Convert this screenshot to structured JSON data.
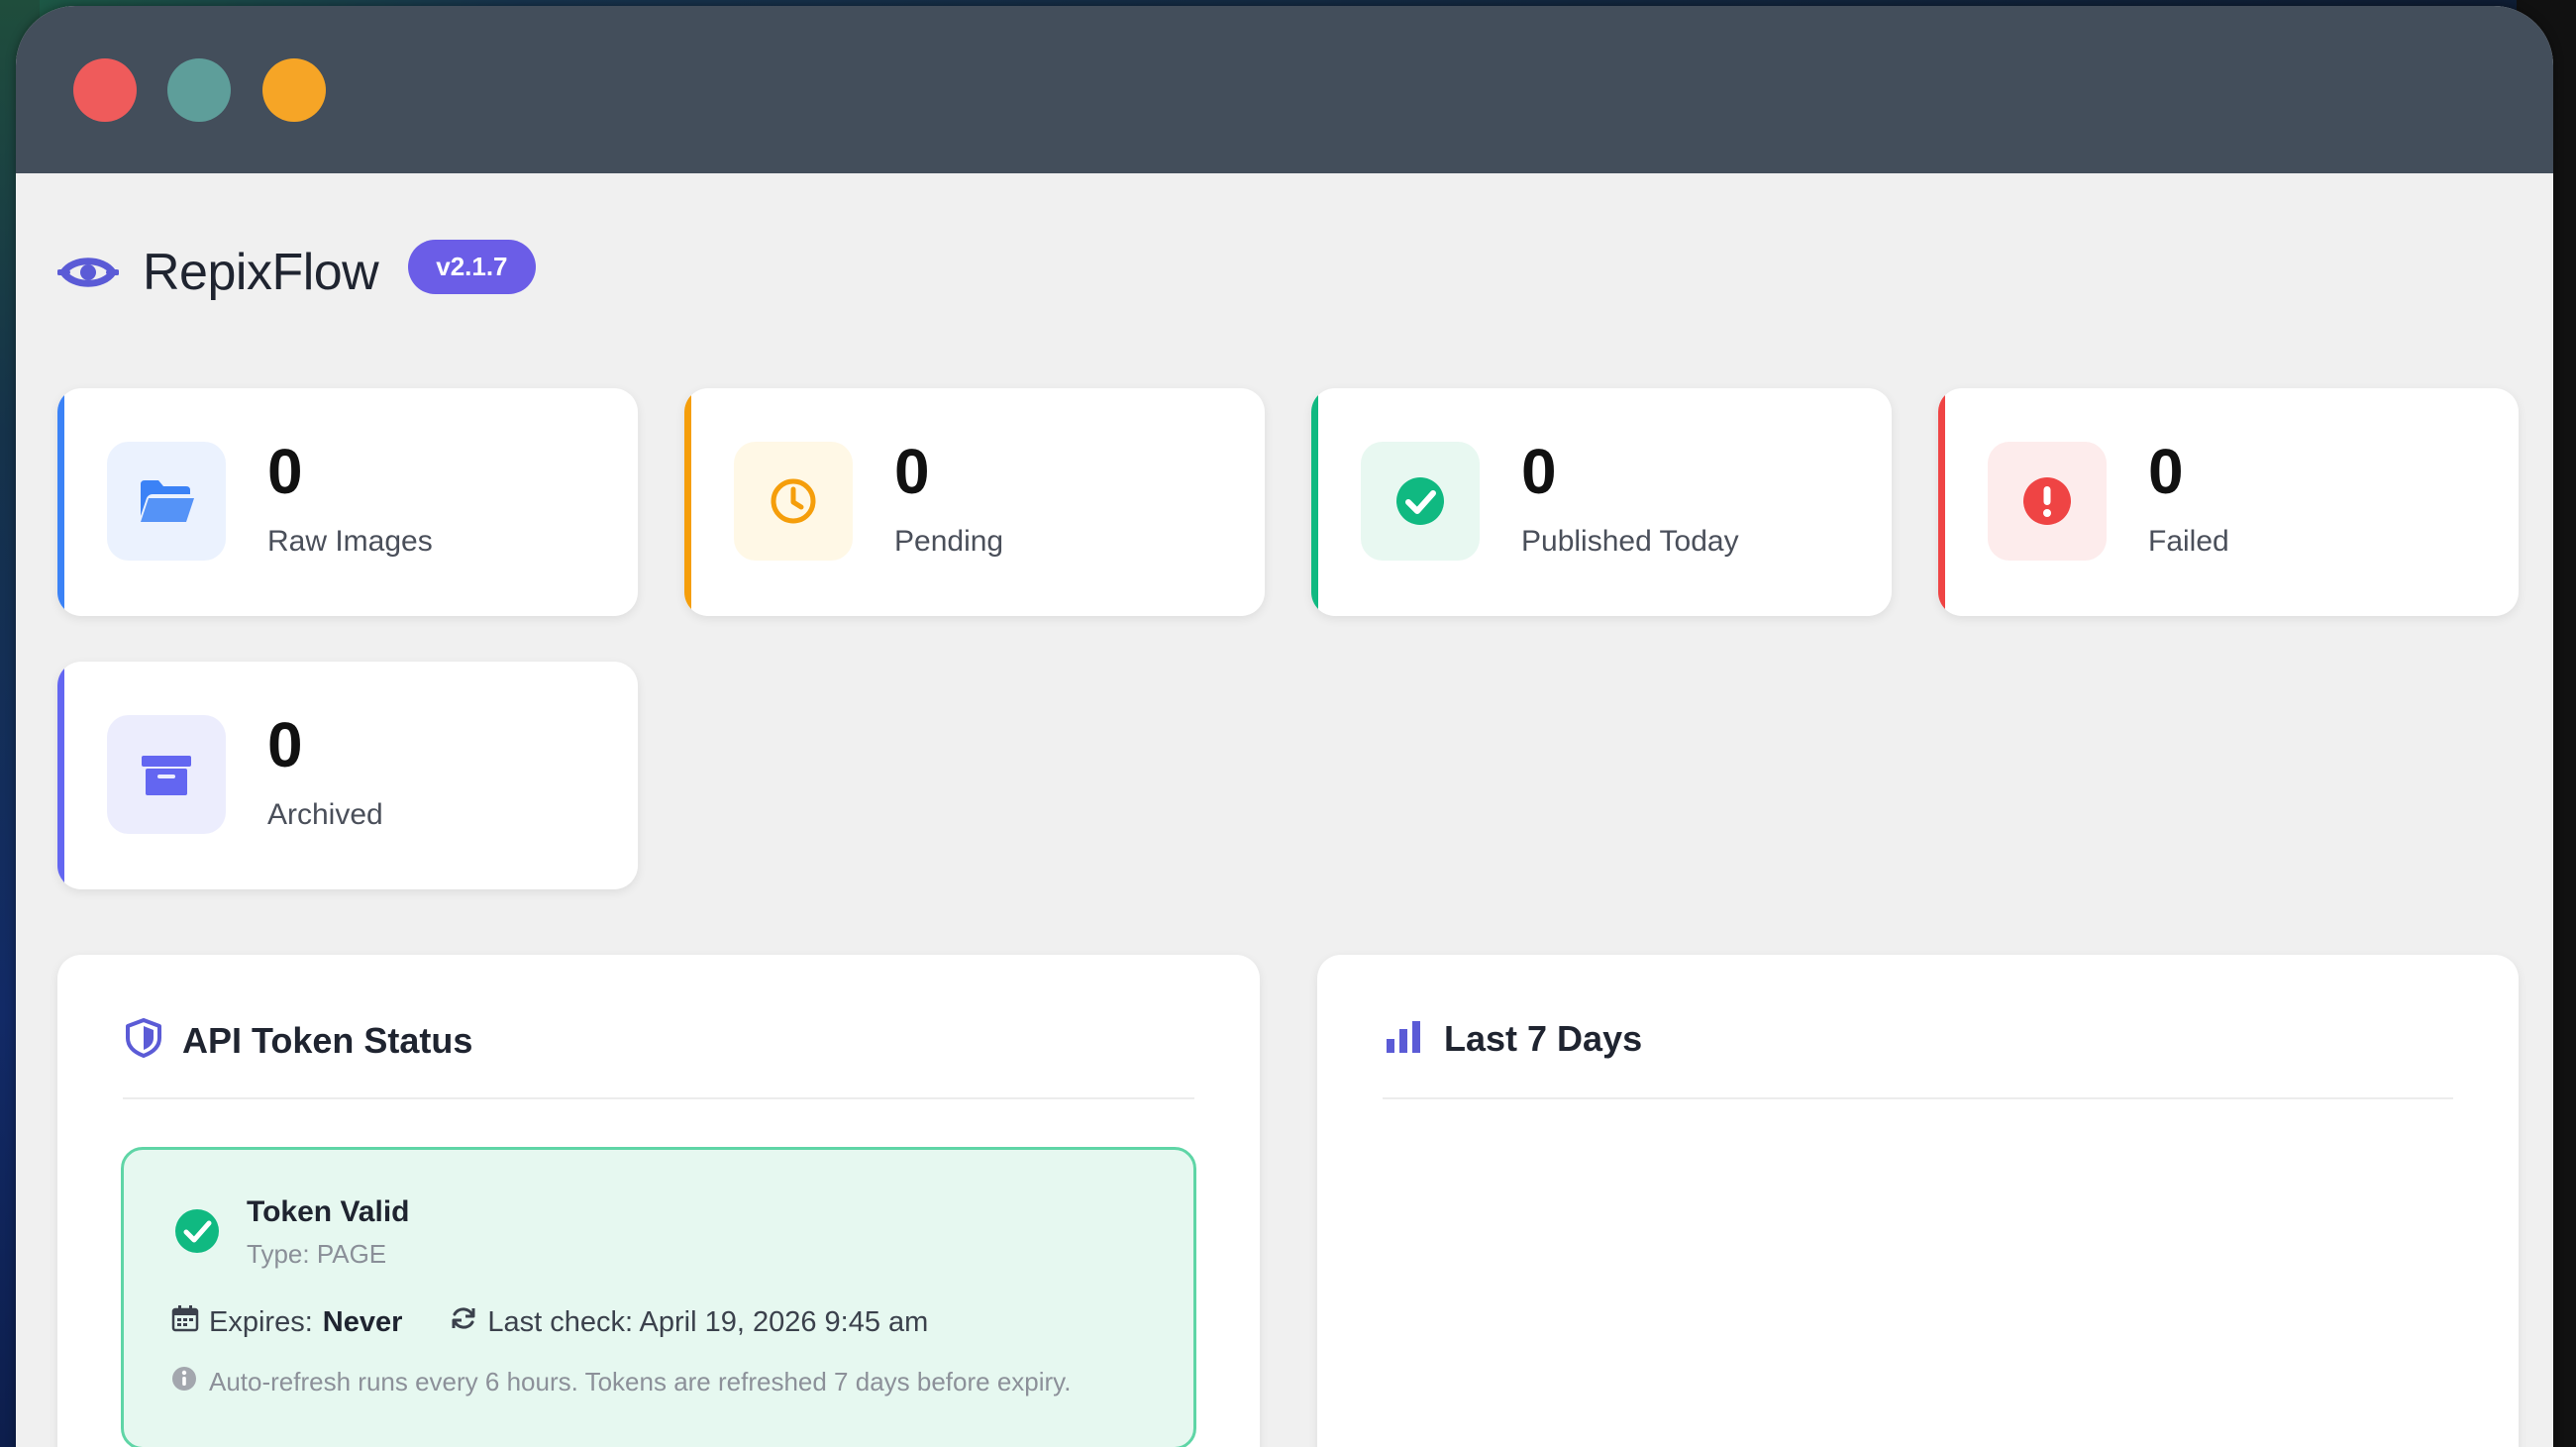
{
  "window": {
    "controls": [
      "close",
      "minimize",
      "maximize"
    ]
  },
  "brand": {
    "name": "RepixFlow",
    "version": "v2.1.7",
    "logo_icon": "eye-logo-icon"
  },
  "colors": {
    "accent": "#6b5de7",
    "blue": "#3b82f6",
    "orange": "#f59e0b",
    "green": "#10b981",
    "red": "#ef4444",
    "purple": "#6366f1"
  },
  "stats": [
    {
      "value": "0",
      "label": "Raw Images",
      "icon": "folder-open-icon"
    },
    {
      "value": "0",
      "label": "Pending",
      "icon": "clock-icon"
    },
    {
      "value": "0",
      "label": "Published Today",
      "icon": "check-circle-icon"
    },
    {
      "value": "0",
      "label": "Failed",
      "icon": "alert-circle-icon"
    },
    {
      "value": "0",
      "label": "Archived",
      "icon": "archive-box-icon"
    }
  ],
  "token_panel": {
    "title": "API Token Status",
    "icon": "shield-icon",
    "status_title": "Token Valid",
    "type_text": "Type: PAGE",
    "expires_label": "Expires:",
    "expires_value": "Never",
    "last_check": "Last check: April 19, 2026 9:45 am",
    "note": "Auto-refresh runs every 6 hours. Tokens are refreshed 7 days before expiry."
  },
  "chart_panel": {
    "title": "Last 7 Days",
    "icon": "bar-chart-icon"
  }
}
